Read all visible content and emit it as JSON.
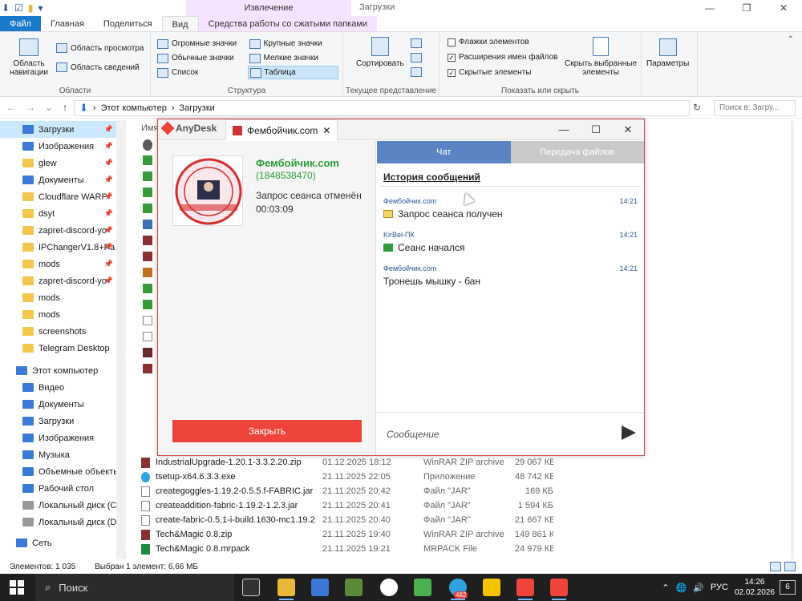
{
  "ribbon_tabs": {
    "file": "Файл",
    "home": "Главная",
    "share": "Поделиться",
    "view": "Вид",
    "ctx_header": "Извлечение",
    "ctx_tab": "Средства работы со сжатыми папками"
  },
  "window_title": "Загрузки",
  "ribbon": {
    "nav_pane": "Область навигации",
    "preview_pane": "Область просмотра",
    "details_pane": "Область сведений",
    "areas_label": "Области",
    "layouts": [
      "Огромные значки",
      "Крупные значки",
      "Обычные значки",
      "Мелкие значки",
      "Список",
      "Таблица"
    ],
    "structure_label": "Структура",
    "sort": "Сортировать",
    "current_view_label": "Текущее представление",
    "item_checkboxes": "Флажки элементов",
    "extensions": "Расширения имен файлов",
    "hidden_items": "Скрытые элементы",
    "hide_selected": "Скрыть выбранные элементы",
    "show_hide_label": "Показать или скрыть",
    "params": "Параметры"
  },
  "address": {
    "path": [
      "Этот компьютер",
      "Загрузки"
    ],
    "search_placeholder": "Поиск в: Загру..."
  },
  "sidebar": {
    "items": [
      {
        "label": "Загрузки",
        "pinned": true
      },
      {
        "label": "Изображения",
        "pinned": true
      },
      {
        "label": "glew",
        "pinned": true
      },
      {
        "label": "Документы",
        "pinned": true
      },
      {
        "label": "Cloudflare WARP",
        "pinned": true
      },
      {
        "label": "dsyt",
        "pinned": true
      },
      {
        "label": "zapret-discord-yo",
        "pinned": true
      },
      {
        "label": "IPChangerV1.8+Pa",
        "pinned": true
      },
      {
        "label": "mods",
        "pinned": true
      },
      {
        "label": "zapret-discord-yo",
        "pinned": true
      },
      {
        "label": "mods"
      },
      {
        "label": "mods"
      },
      {
        "label": "screenshots"
      },
      {
        "label": "Telegram Desktop"
      },
      {
        "label": "Этот компьютер"
      },
      {
        "label": "Видео"
      },
      {
        "label": "Документы"
      },
      {
        "label": "Загрузки"
      },
      {
        "label": "Изображения"
      },
      {
        "label": "Музыка"
      },
      {
        "label": "Объемные объекты"
      },
      {
        "label": "Рабочий стол"
      },
      {
        "label": "Локальный диск (C:)"
      },
      {
        "label": "Локальный диск (D:)"
      },
      {
        "label": "Сеть"
      }
    ]
  },
  "filelist": {
    "col_name": "Имя",
    "rows": [
      {
        "name": "IndustrialUpgrade-1.20.1-3.3.2.20.zip",
        "date": "01.12.2025 18:12",
        "type": "WinRAR ZIP archive",
        "size": "29 067 КБ"
      },
      {
        "name": "tsetup-x64.6.3.3.exe",
        "date": "21.11.2025 22:05",
        "type": "Приложение",
        "size": "48 742 КБ"
      },
      {
        "name": "creategoggles-1.19.2-0.5.5.f-FABRIC.jar",
        "date": "21.11.2025 20:42",
        "type": "Файл \"JAR\"",
        "size": "169 КБ"
      },
      {
        "name": "createaddition-fabric-1.19.2-1.2.3.jar",
        "date": "21.11.2025 20:41",
        "type": "Файл \"JAR\"",
        "size": "1 594 КБ"
      },
      {
        "name": "create-fabric-0.5.1-i-build.1630-mc1.19.2...",
        "date": "21.11.2025 20:40",
        "type": "Файл \"JAR\"",
        "size": "21 667 КБ"
      },
      {
        "name": "Tech&Magic 0.8.zip",
        "date": "21.11.2025 19:40",
        "type": "WinRAR ZIP archive",
        "size": "149 861 КБ"
      },
      {
        "name": "Tech&Magic 0.8.mrpack",
        "date": "21.11.2025 19:21",
        "type": "MRPACK File",
        "size": "24 979 КБ"
      }
    ]
  },
  "status": {
    "count": "Элементов: 1 035",
    "selected": "Выбран 1 элемент: 6,66 МБ"
  },
  "taskbar": {
    "search": "Поиск",
    "lang": "РУС",
    "time": "14:26",
    "date": "02.02.2026",
    "badge": "482",
    "notif": "6"
  },
  "anydesk": {
    "app": "AnyDesk",
    "tab": "Фембойчик.com",
    "name": "Фембойчик.com",
    "id": "(1848538470)",
    "status": "Запрос сеанса отменён",
    "timer": "00:03:09",
    "close_btn": "Закрыть",
    "chat_tab": "Чат",
    "files_tab": "Передача файлов",
    "history": "История сообщений",
    "messages": [
      {
        "who": "Фембойчик.com",
        "time": "14:21",
        "text": "Запрос сеанса получен"
      },
      {
        "who": "KirBel-ПК",
        "time": "14:21",
        "text": "Сеанс начался"
      },
      {
        "who": "Фембойчик.com",
        "time": "14:21",
        "text": "Тронешь мышку - бан"
      }
    ],
    "input_placeholder": "Сообщение"
  },
  "colors": {
    "accent": "#1979ca",
    "anydesk_red": "#ef443b",
    "green": "#2f9e3a",
    "chat_tab": "#5a84c4"
  }
}
